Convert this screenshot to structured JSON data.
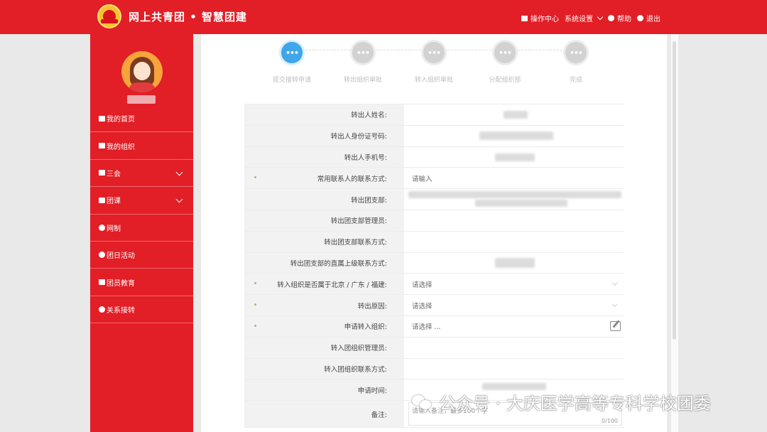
{
  "header": {
    "app_title": "网上共青团 • 智慧团建",
    "menu": [
      {
        "icon": "envelope-icon",
        "label": "操作中心"
      },
      {
        "icon": "settings-icon",
        "label": "系统设置"
      },
      {
        "icon": "help-icon",
        "label": "帮助"
      },
      {
        "icon": "power-icon",
        "label": "退出"
      }
    ],
    "brand_color": "#e21e26"
  },
  "sidebar": {
    "items": [
      {
        "icon": "home-icon",
        "label": "我的首页",
        "expandable": false
      },
      {
        "icon": "group-icon",
        "label": "我的组织",
        "expandable": false
      },
      {
        "icon": "checkbox-icon",
        "label": "三会",
        "expandable": true
      },
      {
        "icon": "folder-icon",
        "label": "团课",
        "expandable": true
      },
      {
        "icon": "target-icon",
        "label": "网制",
        "expandable": false
      },
      {
        "icon": "recycle-icon",
        "label": "团日活动",
        "expandable": false
      },
      {
        "icon": "graduation-cap-icon",
        "label": "团员教育",
        "expandable": false
      },
      {
        "icon": "refresh-icon",
        "label": "关系接转",
        "expandable": false
      }
    ]
  },
  "steps": [
    {
      "label": "提交接转申请",
      "active": true
    },
    {
      "label": "转出组织审批",
      "active": false
    },
    {
      "label": "转入组织审批",
      "active": false
    },
    {
      "label": "分配组织部",
      "active": false
    },
    {
      "label": "完成",
      "active": false
    }
  ],
  "form": {
    "rows": [
      {
        "label": "转出人姓名:",
        "value": "",
        "type": "blurred",
        "required": false
      },
      {
        "label": "转出人身份证号码:",
        "value": "",
        "type": "blurred",
        "required": false
      },
      {
        "label": "转出人手机号:",
        "value": "",
        "type": "blurred",
        "required": false
      },
      {
        "label": "常用联系人的联系方式:",
        "value": "请输入",
        "type": "input",
        "required": true
      },
      {
        "label": "转出团支部:",
        "value": "",
        "type": "blurred",
        "required": false
      },
      {
        "label": "转出团支部管理员:",
        "value": "",
        "type": "text",
        "required": false
      },
      {
        "label": "转出团支部联系方式:",
        "value": "",
        "type": "text",
        "required": false
      },
      {
        "label": "转出团支部的直属上级联系方式:",
        "value": "",
        "type": "blurred",
        "required": false
      },
      {
        "label": "转入组织是否属于北京 / 广东 / 福建:",
        "value": "请选择",
        "type": "select",
        "required": true
      },
      {
        "label": "转出原因:",
        "value": "请选择",
        "type": "select",
        "required": true
      },
      {
        "label": "申请转入组织:",
        "value": "请选择 ...",
        "type": "picker",
        "required": true
      },
      {
        "label": "转入团组织管理员:",
        "value": "",
        "type": "text",
        "required": false
      },
      {
        "label": "转入团组织联系方式:",
        "value": "",
        "type": "text",
        "required": false
      },
      {
        "label": "申请时间:",
        "value": "",
        "type": "blurred",
        "required": false
      },
      {
        "label": "备注:",
        "value": "请输入备注，最多100个字",
        "type": "textarea",
        "required": false,
        "counter": "0/100"
      }
    ]
  },
  "watermark": {
    "text": "公众号 · 大庆医学高等专科学校团委"
  }
}
